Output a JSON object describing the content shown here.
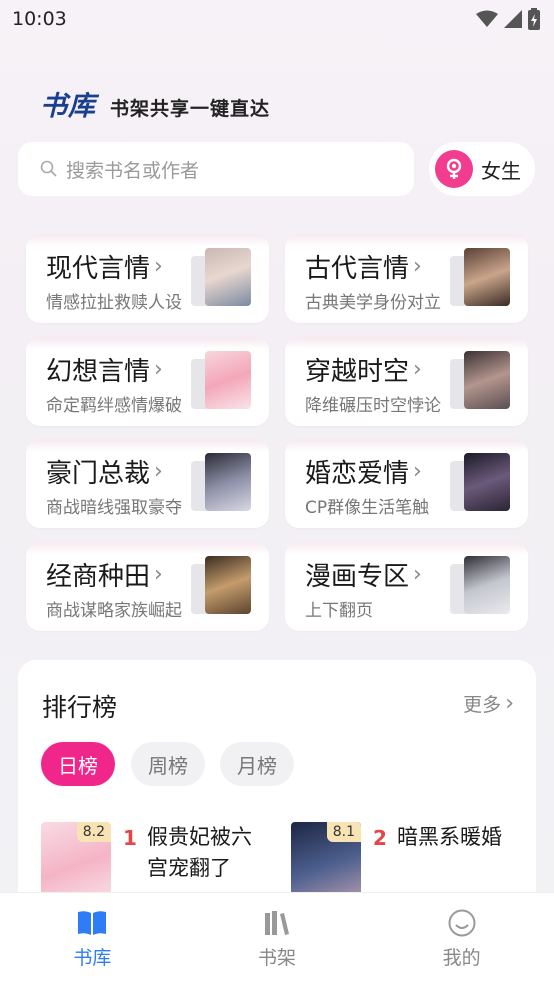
{
  "status": {
    "time": "10:03"
  },
  "header": {
    "title": "书库",
    "subtitle": "书架共享一键直达"
  },
  "search": {
    "placeholder": "搜索书名或作者"
  },
  "gender": {
    "label": "女生"
  },
  "categories": [
    {
      "title": "现代言情",
      "desc": "情感拉扯救赎人设"
    },
    {
      "title": "古代言情",
      "desc": "古典美学身份对立"
    },
    {
      "title": "幻想言情",
      "desc": "命定羁绊感情爆破"
    },
    {
      "title": "穿越时空",
      "desc": "降维碾压时空悖论"
    },
    {
      "title": "豪门总裁",
      "desc": "商战暗线强取豪夺"
    },
    {
      "title": "婚恋爱情",
      "desc": "CP群像生活笔触"
    },
    {
      "title": "经商种田",
      "desc": "商战谋略家族崛起"
    },
    {
      "title": "漫画专区",
      "desc": "上下翻页"
    }
  ],
  "ranking": {
    "title": "排行榜",
    "more": "更多",
    "tabs": [
      "日榜",
      "周榜",
      "月榜"
    ],
    "books": [
      {
        "rank": "1",
        "title": "假贵妃被六宫宠翻了",
        "score": "8.2"
      },
      {
        "rank": "2",
        "title": "暗黑系暖婚",
        "score": "8.1"
      }
    ]
  },
  "tabbar": {
    "items": [
      "书库",
      "书架",
      "我的"
    ]
  },
  "colors": {
    "accent": "#f0268a",
    "brand": "#1b3f8f",
    "active_tab": "#2e7df6"
  }
}
